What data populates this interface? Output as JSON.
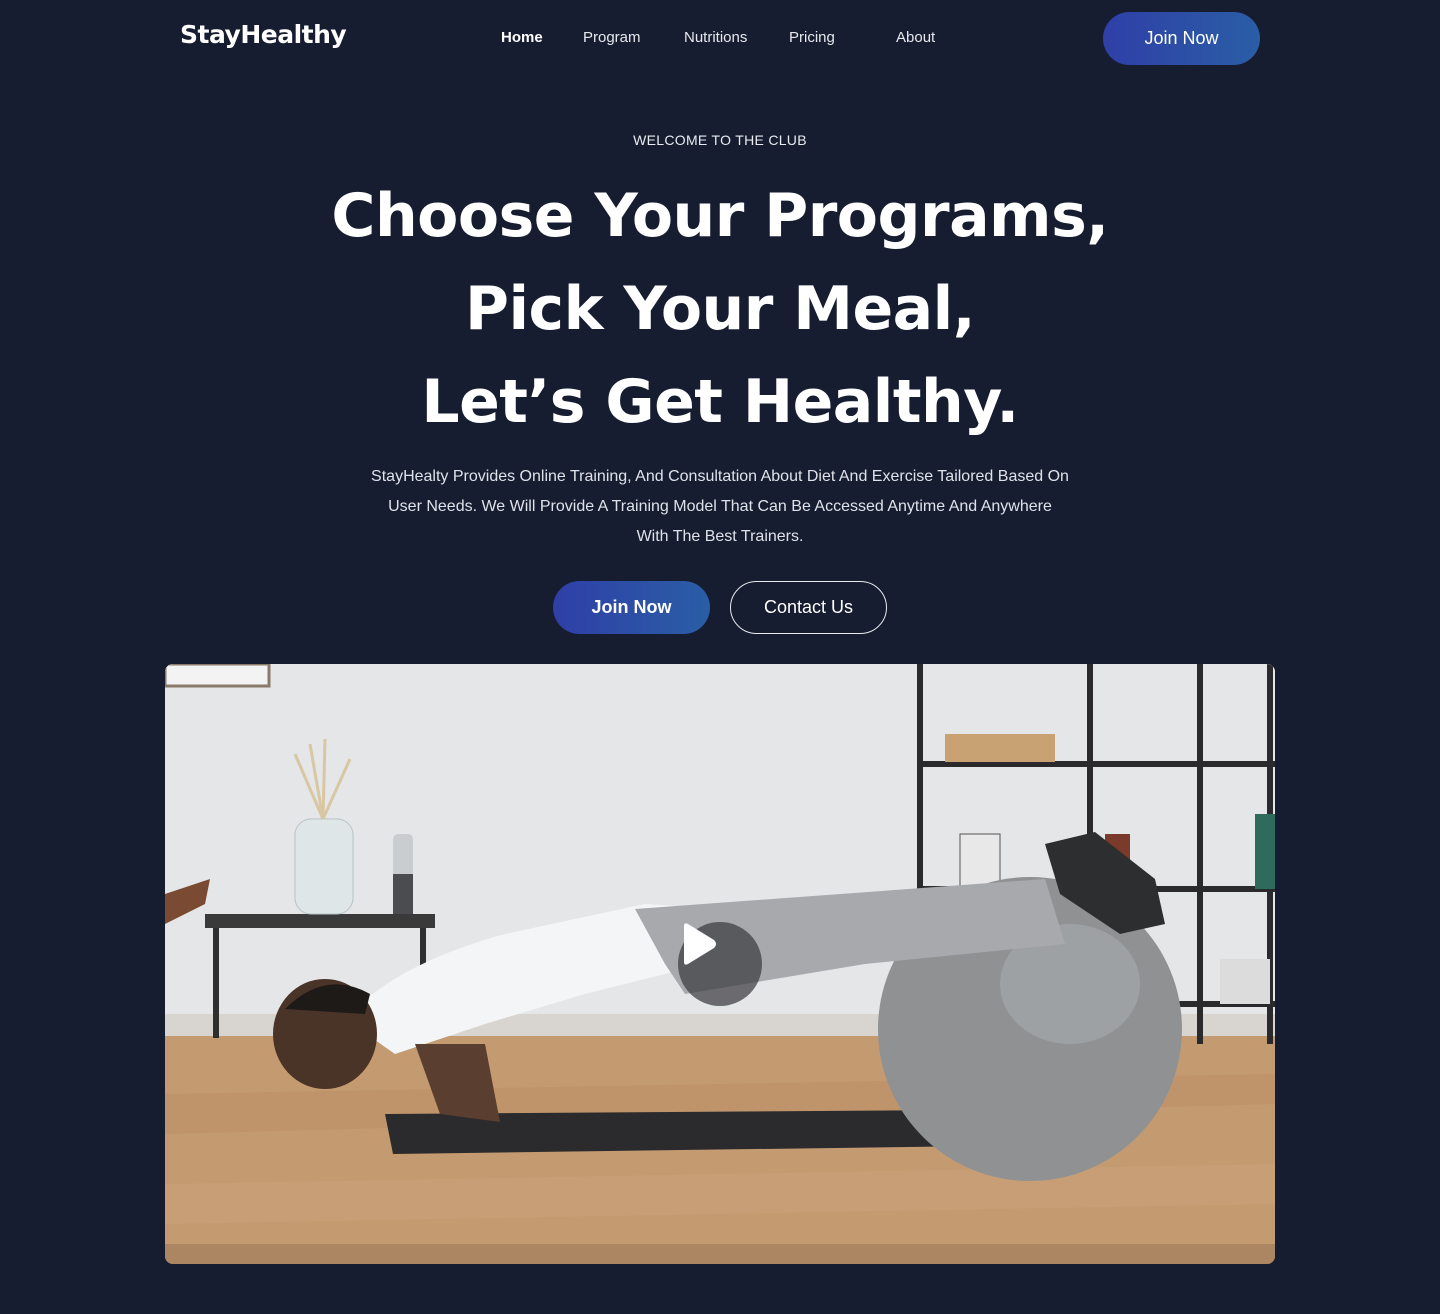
{
  "nav": {
    "logo": "StayHealthy",
    "items": [
      {
        "label": "Home",
        "active": true
      },
      {
        "label": "Program"
      },
      {
        "label": "Nutritions"
      },
      {
        "label": "Pricing"
      },
      {
        "label": "About"
      }
    ],
    "cta": "Join Now"
  },
  "hero": {
    "eyebrow": "WELCOME TO THE CLUB",
    "headline": [
      "Choose Your Programs,",
      "Pick Your Meal,",
      "Let’s Get Healthy."
    ],
    "description": "StayHealty Provides Online Training, And Consultation About Diet And Exercise Tailored Based On User Needs. We Will Provide A Training Model That Can Be Accessed Anytime And Anywhere With The Best Trainers.",
    "primary_button": "Join Now",
    "secondary_button": "Contact Us"
  },
  "video": {
    "play_icon": "play-icon"
  },
  "colors": {
    "background": "#171d30",
    "accent_start": "#2f3fa7",
    "accent_end": "#2a5ea6"
  }
}
